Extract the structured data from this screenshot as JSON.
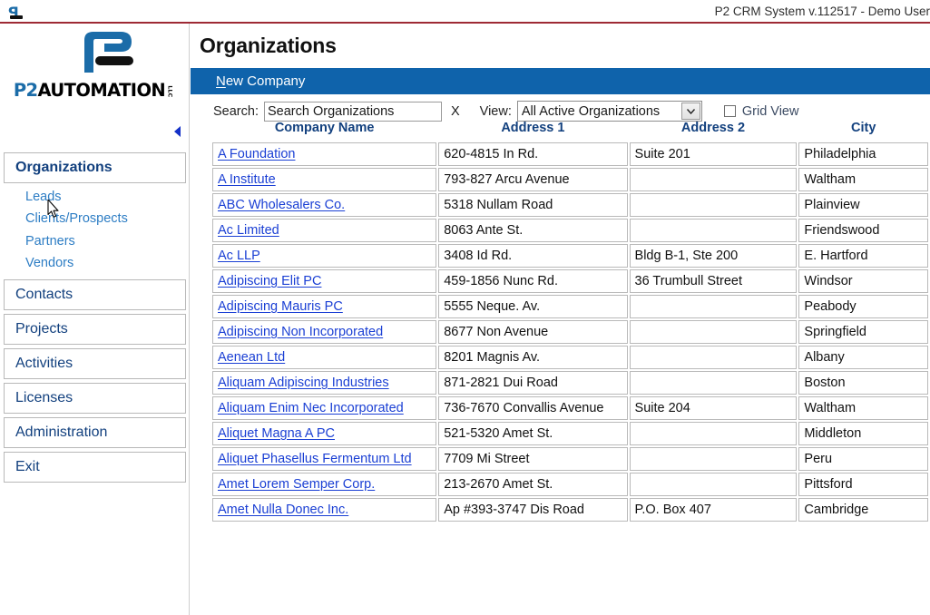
{
  "window": {
    "title": "P2 CRM System v.112517 - Demo User",
    "app_icon": "p2-logo-icon"
  },
  "branding": {
    "logo_p2": "P2",
    "logo_automation": "AUTOMATION",
    "logo_llc": "LLC"
  },
  "sidebar": {
    "collapse_icon": "chevron-left-icon",
    "groups": [
      {
        "label": "Organizations",
        "active": true,
        "sub_items": [
          {
            "label": "Leads"
          },
          {
            "label": "Clients/Prospects"
          },
          {
            "label": "Partners"
          },
          {
            "label": "Vendors"
          }
        ]
      },
      {
        "label": "Contacts",
        "sub_items": []
      },
      {
        "label": "Projects",
        "sub_items": []
      },
      {
        "label": "Activities",
        "sub_items": []
      },
      {
        "label": "Licenses",
        "sub_items": []
      },
      {
        "label": "Administration",
        "sub_items": []
      },
      {
        "label": "Exit",
        "sub_items": []
      }
    ]
  },
  "page": {
    "title": "Organizations",
    "action_button": "New Company",
    "action_button_accel": "N"
  },
  "filters": {
    "search_label": "Search:",
    "search_placeholder": "Search Organizations",
    "search_value": "",
    "clear_label": "X",
    "view_label": "View:",
    "view_selected": "All Active Organizations",
    "view_options": [
      "All Active Organizations"
    ],
    "grid_view_label": "Grid View",
    "grid_view_checked": false,
    "dropdown_icon": "chevron-down-icon"
  },
  "table": {
    "columns": [
      "Company Name",
      "Address 1",
      "Address 2",
      "City"
    ],
    "rows": [
      {
        "company": "A Foundation",
        "address1": "620-4815 In Rd.",
        "address2": "Suite 201",
        "city": "Philadelphia"
      },
      {
        "company": "A Institute",
        "address1": "793-827 Arcu Avenue",
        "address2": "",
        "city": "Waltham"
      },
      {
        "company": "ABC Wholesalers Co.",
        "address1": "5318 Nullam Road",
        "address2": "",
        "city": "Plainview"
      },
      {
        "company": "Ac Limited",
        "address1": "8063 Ante St.",
        "address2": "",
        "city": "Friendswood"
      },
      {
        "company": "Ac LLP",
        "address1": "3408 Id Rd.",
        "address2": "Bldg B-1, Ste 200",
        "city": "E. Hartford"
      },
      {
        "company": "Adipiscing Elit PC",
        "address1": "459-1856 Nunc Rd.",
        "address2": "36 Trumbull Street",
        "city": "Windsor"
      },
      {
        "company": "Adipiscing Mauris PC",
        "address1": "5555 Neque. Av.",
        "address2": "",
        "city": "Peabody"
      },
      {
        "company": "Adipiscing Non Incorporated",
        "address1": "8677 Non Avenue",
        "address2": "",
        "city": "Springfield"
      },
      {
        "company": "Aenean Ltd",
        "address1": "8201 Magnis Av.",
        "address2": "",
        "city": "Albany"
      },
      {
        "company": "Aliquam Adipiscing Industries",
        "address1": "871-2821 Dui Road",
        "address2": "",
        "city": "Boston"
      },
      {
        "company": "Aliquam Enim Nec Incorporated",
        "address1": "736-7670 Convallis Avenue",
        "address2": "Suite 204",
        "city": "Waltham"
      },
      {
        "company": "Aliquet Magna A PC",
        "address1": "521-5320 Amet St.",
        "address2": "",
        "city": "Middleton"
      },
      {
        "company": "Aliquet Phasellus Fermentum Ltd",
        "address1": "7709 Mi Street",
        "address2": "",
        "city": "Peru"
      },
      {
        "company": "Amet Lorem Semper Corp.",
        "address1": "213-2670 Amet St.",
        "address2": "",
        "city": "Pittsford"
      },
      {
        "company": "Amet Nulla Donec Inc.",
        "address1": "Ap #393-3747 Dis Road",
        "address2": "P.O. Box 407",
        "city": "Cambridge"
      }
    ]
  },
  "colors": {
    "accent_blue": "#0f63ab",
    "title_rule_red": "#9e2a35",
    "nav_text": "#12407e",
    "nav_sub_text": "#2d7dc4",
    "link_blue": "#1a3fd4"
  }
}
